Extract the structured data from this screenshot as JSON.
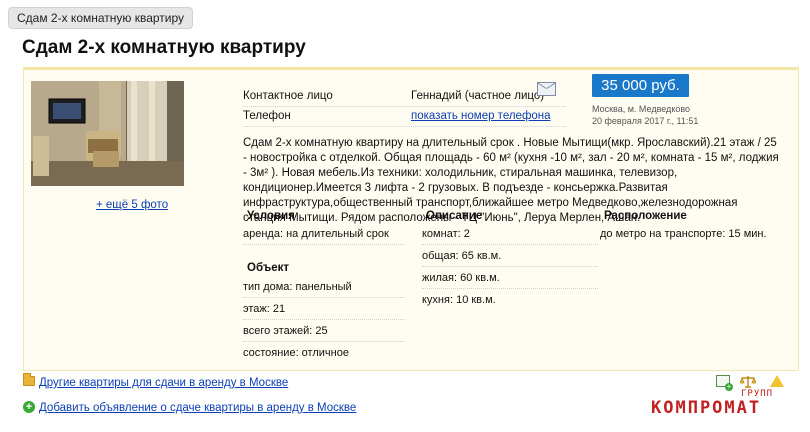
{
  "tab": {
    "label": "Сдам 2-х комнатную квартиру"
  },
  "page": {
    "title": "Сдам 2-х комнатную квартиру"
  },
  "photos": {
    "more_link": "+ ещё 5 фото"
  },
  "contact": {
    "person_label": "Контактное лицо",
    "person_value": "Геннадий (частное лицо)",
    "phone_label": "Телефон",
    "phone_link": "показать номер телефона"
  },
  "listing": {
    "price": "35 000 руб.",
    "location": "Москва, м. Медведково",
    "date": "20 февраля 2017 г., 11:51",
    "description": "Сдам 2-х комнатную квартиру на длительный срок . Новые Мытищи(мкр. Ярославский).21 этаж / 25 - новостройка с отделкой. Общая площадь - 60 м² (кухня -10 м², зал - 20 м², комната - 15 м², лоджия - 3м² ). Новая мебель.Из техники: холодильник, стиральная машинка, телевизор, кондиционер.Имеется 3 лифта - 2 грузовых. В подъезде - консьержка.Развитая инфраструктура,общественный транспорт,ближайшее метро Медведково,железнодорожная станция Мытищи. Рядом расположены - ТЦ \"Июнь\", Леруа Мерлен, Ашан."
  },
  "details": {
    "conditions": {
      "heading": "Условия",
      "rows": [
        "аренда: на длительный срок"
      ]
    },
    "object": {
      "heading": "Объект",
      "rows": [
        "тип дома: панельный",
        "этаж: 21",
        "всего этажей: 25",
        "состояние: отличное"
      ]
    },
    "description": {
      "heading": "Описание",
      "rows": [
        "комнат: 2",
        "общая: 65 кв.м.",
        "жилая: 60 кв.м.",
        "кухня: 10 кв.м."
      ]
    },
    "location": {
      "heading": "Расположение",
      "rows": [
        "до метро на транспорте: 15 мин."
      ]
    }
  },
  "footer": {
    "other_link": "Другие квартиры для сдачи в аренду в Москве",
    "add_link": "Добавить объявление о сдаче квартиры в аренду в Москве"
  },
  "watermark": {
    "main": "КОМПРОМАТ",
    "small": "ГРУПП"
  },
  "icons": {
    "mail": "envelope-icon",
    "folder": "folder-icon",
    "add": "plus-circle-icon",
    "edit": "add-note-icon",
    "compare": "scales-icon",
    "report": "warning-icon"
  },
  "colors": {
    "link": "#0c3fb5",
    "price_bg": "#1a78c9",
    "card_bg": "#fffdf1",
    "watermark": "#c02121"
  }
}
